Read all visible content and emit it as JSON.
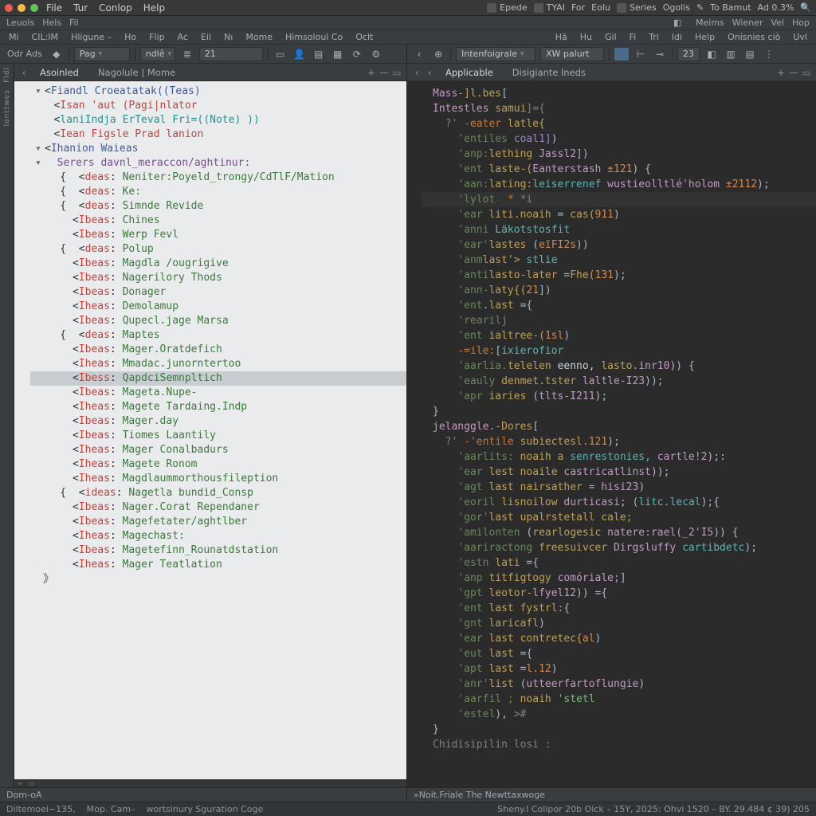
{
  "titlebar": {
    "menu": [
      "File",
      "Tur",
      "Conlop",
      "Help"
    ],
    "right_items": [
      "Epede",
      "TYAI",
      "For",
      "Eolu",
      "Series",
      "Ogolis",
      "To Bamut",
      "Ad 0.3%"
    ]
  },
  "row2_left": [
    "Leuols",
    "Hels",
    "Fil"
  ],
  "row2_right": [
    "Meims",
    "Wiener",
    "Vel",
    "Hop"
  ],
  "tb3_left": [
    "Mi",
    "CIL:IM",
    "Hligune –",
    "Ho",
    "Flip",
    "Ac",
    "Eil",
    "Nı",
    "Mome",
    "Himsoloul Co",
    "Oclt"
  ],
  "tb3_right": [
    "Hä",
    "Hu",
    "Gil",
    "Fi",
    "Tri",
    "ldi",
    "Help",
    "Onisnies ciò",
    "Uvl"
  ],
  "toolbar_left": {
    "label1": "Odr Ads",
    "drop1": "Pag",
    "drop2": "ndlê",
    "field": "21"
  },
  "toolbar_right": {
    "drop1": "Intenfoigrale",
    "drop2": "XW palurt",
    "num": "23"
  },
  "left_tabs": [
    "Asoinled",
    "Nagolule | Mome"
  ],
  "right_tabs": [
    "Applicable",
    "Disigiante lneds"
  ],
  "left_tree": {
    "root": "Fiandl Croeatatak((Teas)",
    "sub1": "Isan 'aut (Pagi|nlator",
    "sub2": "laniIndja ErTeval Fri=((Note) ))",
    "sub3": "Iean Figsle Prad lanion",
    "sect": "Ihanion Waieas",
    "srvtitle": "Serers davnl_meraccon/aghtinur:",
    "items": [
      {
        "k": "deas",
        "v": "Neniter:Poyeld_trongy/CdTlF/Mation"
      },
      {
        "k": "deas",
        "v": "Ke:"
      },
      {
        "k": "deas",
        "v": "Simnde Revide"
      },
      {
        "k": "Ibeas",
        "v": "Chines"
      },
      {
        "k": "Ibeas",
        "v": "Werp Fevl"
      },
      {
        "k": "deas",
        "v": "Polup"
      },
      {
        "k": "Ibeas",
        "v": "Magdla /ougrigive"
      },
      {
        "k": "Ibeas",
        "v": "Nagerilory Thods"
      },
      {
        "k": "Ibeas",
        "v": "Donager"
      },
      {
        "k": "Iheas",
        "v": "Demolamup"
      },
      {
        "k": "Ibeas",
        "v": "Qupecl.jage Marsa"
      },
      {
        "k": "deas",
        "v": "Maptes"
      },
      {
        "k": "Ibeas",
        "v": "Mager.Oratdefich"
      },
      {
        "k": "Iheas",
        "v": "Mmadac.junorntertoo"
      },
      {
        "k": "Ibess",
        "v": "QapdciSemnpltich",
        "sel": true
      },
      {
        "k": "Ibeas",
        "v": "Mageta.Nupe-"
      },
      {
        "k": "Iheas",
        "v": "Magete Tardaing.Indp"
      },
      {
        "k": "Ibeas",
        "v": "Mager.day"
      },
      {
        "k": "Ibeas",
        "v": "Tiomes Laantily"
      },
      {
        "k": "Iheas",
        "v": "Mager Conalbadurs"
      },
      {
        "k": "Iheas",
        "v": "Magete Ronom"
      },
      {
        "k": "Iheas",
        "v": "Magdlaummorthousfileption"
      },
      {
        "k": "ideas",
        "v": "Nagetla bundid_Consp"
      },
      {
        "k": "Ibeas",
        "v": "Nager.Corat Rependaner"
      },
      {
        "k": "Ibeas",
        "v": "Magefetater/aghtlber"
      },
      {
        "k": "Iheas",
        "v": "Magechast:"
      },
      {
        "k": "Ibeas",
        "v": "Magetefinn_Rounatdstation"
      },
      {
        "k": "Iheas",
        "v": "Mager Teatlation"
      }
    ]
  },
  "code": [
    {
      "cls": "",
      "html": "<span class='d-fn'>Mass-</span><span class='d-id'>]l.bes</span>["
    },
    {
      "cls": "",
      "html": "<span class='d-fn'>Intestles</span> <span class='d-id'>samui</span><span class='d-grey'>]={</span>"
    },
    {
      "cls": "",
      "html": "  <span class='d-grey'>?'</span> <span class='d-key'>-eater</span> <span class='d-id'>latle{</span>"
    },
    {
      "cls": "",
      "html": "    <span class='d-str'>'entiles</span> <span class='d-lav'>coal1]</span>)"
    },
    {
      "cls": "",
      "html": "    <span class='d-str'>'anp:</span><span class='d-id'>lething</span> <span class='d-fn'>Jassl2]</span>)"
    },
    {
      "cls": "",
      "html": "    <span class='d-str'>'ent</span> <span class='d-id'>laste-(</span><span class='d-fn'>Eanterstash</span> <span class='d-num'>±121</span>) {"
    },
    {
      "cls": "",
      "html": "    <span class='d-str'>'aan:</span><span class='d-id'>lating:</span><span class='d-teal'>leiserrenef</span> <span class='d-fn'>wustieolltlé'holom</span> <span class='d-num'>±2112</span>);"
    },
    {
      "cls": "hl",
      "html": "    <span class='d-str'>'lylot</span>  <span class='d-key'>*</span> <span class='d-grey'>*i</span>"
    },
    {
      "cls": "",
      "html": "    <span class='d-str'>'ear</span> <span class='d-id'>liti.noaih</span> = <span class='d-id'>cas(</span><span class='d-num'>911</span>)"
    },
    {
      "cls": "",
      "html": "    <span class='d-str'>'anni</span> <span class='d-teal'>Läkotstosfit</span>"
    },
    {
      "cls": "",
      "html": "    <span class='d-str'>'ear'</span><span class='d-id'>lastes</span> (<span class='d-num'>eïFI2s</span>))"
    },
    {
      "cls": "",
      "html": "    <span class='d-str'>'anm</span><span class='d-id'>last'&gt;</span> <span class='d-teal'>stlie</span>"
    },
    {
      "cls": "",
      "html": "    <span class='d-str'>'anti</span><span class='d-id'>lasto-later</span> =<span class='d-id'>Fhe(</span><span class='d-num'>131</span>);"
    },
    {
      "cls": "",
      "html": "    <span class='d-str'>'ann-</span><span class='d-id'>laty{(</span><span class='d-num'>21</span>])"
    },
    {
      "cls": "",
      "html": "    <span class='d-str'>'ent</span>.<span class='d-id'>last</span> ={"
    },
    {
      "cls": "",
      "html": "    <span class='d-str'>'rearilj</span>"
    },
    {
      "cls": "",
      "html": "    <span class='d-str'>'ent</span> <span class='d-id'>ialtree-(</span><span class='d-num'>1sl</span>)"
    },
    {
      "cls": "",
      "html": "    <span class='d-key'>-=ile:</span>[<span class='d-teal'>ixierofior</span>"
    },
    {
      "cls": "",
      "html": "    <span class='d-str'>'aarlia.</span><span class='d-id'>telelen</span> <span class='d-pale'>eenno,</span> <span class='d-id'>lasto.</span><span class='d-fn'>inr10</span>)) {"
    },
    {
      "cls": "",
      "html": "    <span class='d-str'>'eauly</span> <span class='d-id'>denmet.tster</span> <span class='d-fn'>laltle-I23</span>));"
    },
    {
      "cls": "",
      "html": "    <span class='d-str'>'apr</span> <span class='d-id'>iaries</span> (<span class='d-fn'>tlts-I211</span>);"
    },
    {
      "cls": "",
      "html": "}"
    },
    {
      "cls": "",
      "html": "<span class='d-fn'>jelanggle.-</span><span class='d-id'>Dores</span>["
    },
    {
      "cls": "",
      "html": "  <span class='d-grey'>?'</span> <span class='d-key'>-'entile</span> <span class='d-id'>subiectesl.</span><span class='d-num'>121</span>);"
    },
    {
      "cls": "",
      "html": "    <span class='d-str'>'aarlits:</span> <span class='d-id'>noaih a</span> <span class='d-teal'>senrestonies,</span> <span class='d-fn'>cartle!2</span>);:"
    },
    {
      "cls": "",
      "html": "    <span class='d-str'>'ear</span> <span class='d-id'>lest noaile</span> <span class='d-fn'>castricatlinst</span>));"
    },
    {
      "cls": "",
      "html": "    <span class='d-str'>'agt</span> <span class='d-id'>last nairsather</span> = <span class='d-fn'>hisi23</span>)"
    },
    {
      "cls": "",
      "html": "    <span class='d-str'>'eoril</span> <span class='d-id'>lisnoilow</span> <span class='d-fn'>durticasi</span>; (<span class='d-teal'>litc.lecal</span>);{"
    },
    {
      "cls": "",
      "html": "    <span class='d-str'>'gor'</span><span class='d-id'>last upalrstetall</span> <span class='d-id'>cale;</span>"
    },
    {
      "cls": "",
      "html": "    <span class='d-str'>'amilonten</span> (<span class='d-id'>rearlogesic</span> <span class='d-fn'>natere:rael(_2'I5</span>)) {"
    },
    {
      "cls": "",
      "html": "    <span class='d-str'>'aariractong</span> <span class='d-id'>freesuivcer</span> <span class='d-fn'>Dirgsluffy</span> <span class='d-teal'>cartibdetc</span>);"
    },
    {
      "cls": "",
      "html": "    <span class='d-str'>'estn</span> <span class='d-id'>lati</span> ={"
    },
    {
      "cls": "",
      "html": "    <span class='d-str'>'anp</span> <span class='d-id'>titfigtogy</span> <span class='d-fn'>comóriale;</span>]"
    },
    {
      "cls": "",
      "html": "    <span class='d-str'>'gpt</span> <span class='d-id'>leotor-</span><span class='d-fn'>lfyel12</span>)) ={"
    },
    {
      "cls": "",
      "html": "    <span class='d-str'>'ent</span> <span class='d-id'>last fystrl:</span>{"
    },
    {
      "cls": "",
      "html": "    <span class='d-str'>'gnt</span> <span class='d-id'>laricafl</span>)"
    },
    {
      "cls": "",
      "html": "    <span class='d-str'>'ear</span> <span class='d-id'>last contretec{</span><span class='d-num'>al</span>)"
    },
    {
      "cls": "",
      "html": "    <span class='d-str'>'eut</span> <span class='d-id'>last</span> ={"
    },
    {
      "cls": "",
      "html": "    <span class='d-str'>'apt</span> <span class='d-id'>last</span> =<span class='d-num'>l.12</span>)"
    },
    {
      "cls": "",
      "html": "    <span class='d-str'>'anr'</span><span class='d-id'>list</span> (<span class='d-fn'>utteerfartoflungie</span>)"
    },
    {
      "cls": "",
      "html": "    <span class='d-str'>'aarfil ;</span> <span class='d-id'>noaih</span> <span class='d-str2'>'stetl</span>"
    },
    {
      "cls": "",
      "html": "    <span class='d-str'>'estel</span>), <span class='d-grey'>&gt;#</span>"
    },
    {
      "cls": "",
      "html": "}"
    },
    {
      "cls": "",
      "html": "<span class='d-grey'>Chidisipilin losi :</span>"
    }
  ],
  "status_left": "Dom-oA",
  "status_right": "Noit.Friale The Newttaxwoge",
  "footer_left": [
    "Diltemoei~135,",
    "Mop. Cam–",
    "wortsinury Sguration Coge"
  ],
  "footer_right": "Sheny.l Colipor 20b Oick – 15Y, 2025: Ohvi 1520 – BY. 29.484    ¢ 39) 205"
}
